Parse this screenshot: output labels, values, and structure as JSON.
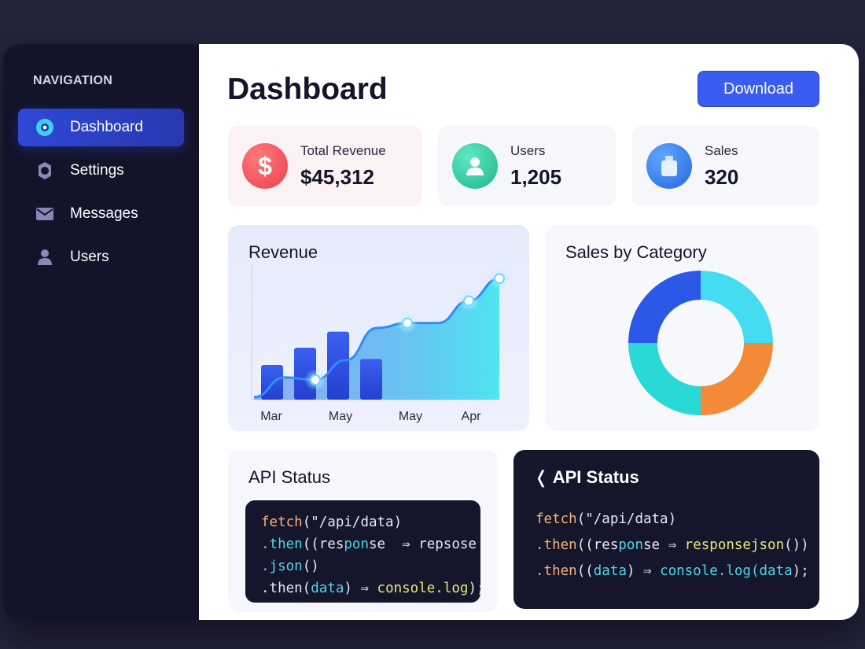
{
  "sidebar": {
    "title": "NAVIGATION",
    "items": [
      {
        "label": "Dashboard",
        "icon": "dashboard-icon",
        "active": true
      },
      {
        "label": "Settings",
        "icon": "settings-icon"
      },
      {
        "label": "Messages",
        "icon": "mail-icon"
      },
      {
        "label": "Users",
        "icon": "user-icon"
      }
    ]
  },
  "header": {
    "title": "Dashboard",
    "download_label": "Download"
  },
  "stats": [
    {
      "label": "Total Revenue",
      "value": "$45,312",
      "icon": "dollar-icon",
      "color": "#f0555e"
    },
    {
      "label": "Users",
      "value": "1,205",
      "icon": "user-icon",
      "color": "#2cc9a0"
    },
    {
      "label": "Sales",
      "value": "320",
      "icon": "bag-icon",
      "color": "#2f7bf2"
    }
  ],
  "revenue": {
    "title": "Revenue"
  },
  "category": {
    "title": "Sales by Category"
  },
  "api_status": {
    "title": "API Status",
    "code": [
      [
        {
          "t": "fetch",
          "c": "orange"
        },
        {
          "t": "(\"/api/data)",
          "c": "white"
        }
      ],
      [
        {
          "t": ".then",
          "c": "cyan"
        },
        {
          "t": "((res",
          "c": "white"
        },
        {
          "t": "pon",
          "c": "cyan"
        },
        {
          "t": "se  ⇒ repsose",
          "c": "white"
        }
      ],
      [
        {
          "t": ".json",
          "c": "cyan"
        },
        {
          "t": "()",
          "c": "white"
        }
      ],
      [
        {
          "t": ".then(",
          "c": "white"
        },
        {
          "t": "data",
          "c": "cyan"
        },
        {
          "t": ") ⇒ ",
          "c": "white"
        },
        {
          "t": "console.log",
          "c": "yellow"
        },
        {
          "t": ");",
          "c": "white"
        }
      ]
    ]
  },
  "api_status_dark": {
    "title": "❬ API Status",
    "code": [
      [
        {
          "t": "fetch",
          "c": "orange"
        },
        {
          "t": "(\"/api/data)",
          "c": "white"
        }
      ],
      [
        {
          "t": ".then",
          "c": "orange"
        },
        {
          "t": "((res",
          "c": "white"
        },
        {
          "t": "pon",
          "c": "cyan"
        },
        {
          "t": "se ⇒ ",
          "c": "white"
        },
        {
          "t": "responsejson",
          "c": "yellow"
        },
        {
          "t": "())",
          "c": "white"
        }
      ],
      [
        {
          "t": ".then",
          "c": "orange"
        },
        {
          "t": "((",
          "c": "white"
        },
        {
          "t": "data",
          "c": "cyan"
        },
        {
          "t": ") ⇒ ",
          "c": "white"
        },
        {
          "t": "console.log(",
          "c": "cyan"
        },
        {
          "t": "data",
          "c": "cyan"
        },
        {
          "t": ");",
          "c": "white"
        }
      ]
    ]
  },
  "chart_data": [
    {
      "type": "bar",
      "title": "Revenue",
      "categories": [
        "Mar",
        "May",
        "May",
        "Apr"
      ],
      "bar_values": [
        28,
        42,
        55,
        33
      ],
      "line_values": [
        2,
        18,
        16,
        32,
        58,
        62,
        62,
        80,
        98
      ],
      "ylim": [
        0,
        100
      ],
      "colors": {
        "bar": "#2f52e8",
        "line": "#2f8ef0",
        "area_top": "#4fe6f0",
        "area_bottom": "#3f6ff0"
      }
    },
    {
      "type": "pie",
      "title": "Sales by Category",
      "values": [
        25,
        25,
        25,
        25
      ],
      "colors": [
        "#44dcf0",
        "#f48a38",
        "#2ad8d6",
        "#2c58e8"
      ],
      "donut": true
    }
  ]
}
